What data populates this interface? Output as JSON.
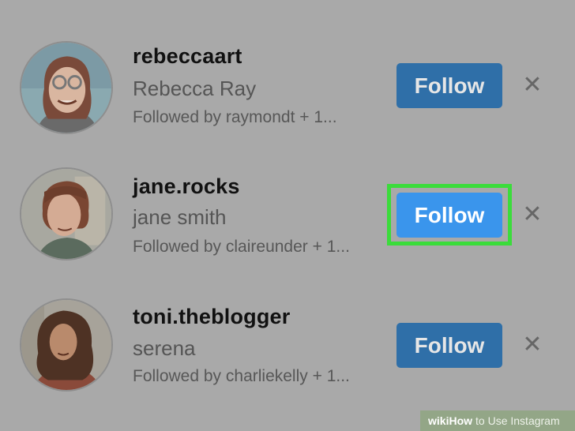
{
  "suggestions": [
    {
      "username": "rebeccaart",
      "full_name": "Rebecca Ray",
      "followed_by": "Followed by raymondt + 1...",
      "follow_label": "Follow",
      "dismiss_glyph": "✕",
      "avatar_icon": "avatar-rebecca-icon"
    },
    {
      "username": "jane.rocks",
      "full_name": "jane smith",
      "followed_by": "Followed by claireunder + 1...",
      "follow_label": "Follow",
      "dismiss_glyph": "✕",
      "avatar_icon": "avatar-jane-icon"
    },
    {
      "username": "toni.theblogger",
      "full_name": "serena",
      "followed_by": "Followed by charliekelly + 1...",
      "follow_label": "Follow",
      "dismiss_glyph": "✕",
      "avatar_icon": "avatar-toni-icon"
    }
  ],
  "watermark": {
    "wiki": "wiki",
    "how": "How",
    "rest": "to Use Instagram"
  },
  "colors": {
    "overlay_background": "#a9a9a9",
    "follow_button": "#2f6fa8",
    "follow_button_active": "#3a95ec",
    "highlight": "#3bdc3b"
  }
}
